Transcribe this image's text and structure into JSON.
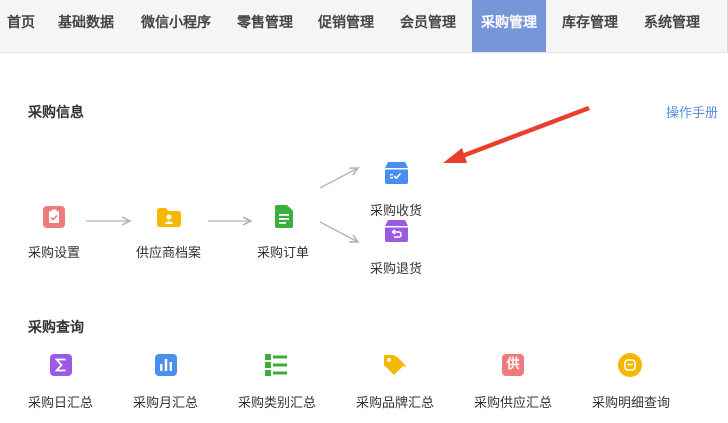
{
  "nav": {
    "items": [
      {
        "label": "首页"
      },
      {
        "label": "基础数据"
      },
      {
        "label": "微信小程序"
      },
      {
        "label": "零售管理"
      },
      {
        "label": "促销管理"
      },
      {
        "label": "会员管理"
      },
      {
        "label": "采购管理",
        "active": true
      },
      {
        "label": "库存管理"
      },
      {
        "label": "系统管理"
      }
    ]
  },
  "purchase_info": {
    "title": "采购信息",
    "manual_link": "操作手册",
    "flow": {
      "settings": "采购设置",
      "supplier_archive": "供应商档案",
      "order": "采购订单",
      "receipt": "采购收货",
      "return": "采购退货"
    }
  },
  "purchase_query": {
    "title": "采购查询",
    "items": [
      {
        "label": "采购日汇总"
      },
      {
        "label": "采购月汇总"
      },
      {
        "label": "采购类别汇总"
      },
      {
        "label": "采购品牌汇总"
      },
      {
        "label": "采购供应汇总",
        "icon_char": "供"
      },
      {
        "label": "采购明细查询"
      }
    ]
  },
  "colors": {
    "nav_active": "#7796d9",
    "link": "#5b8fd7",
    "arrow_red": "#e8402c",
    "icon_pink": "#f07b7b",
    "icon_yellow": "#f5b800",
    "icon_green": "#3cae3c",
    "icon_blue": "#4a8ef0",
    "icon_purple": "#9a5ae6"
  }
}
